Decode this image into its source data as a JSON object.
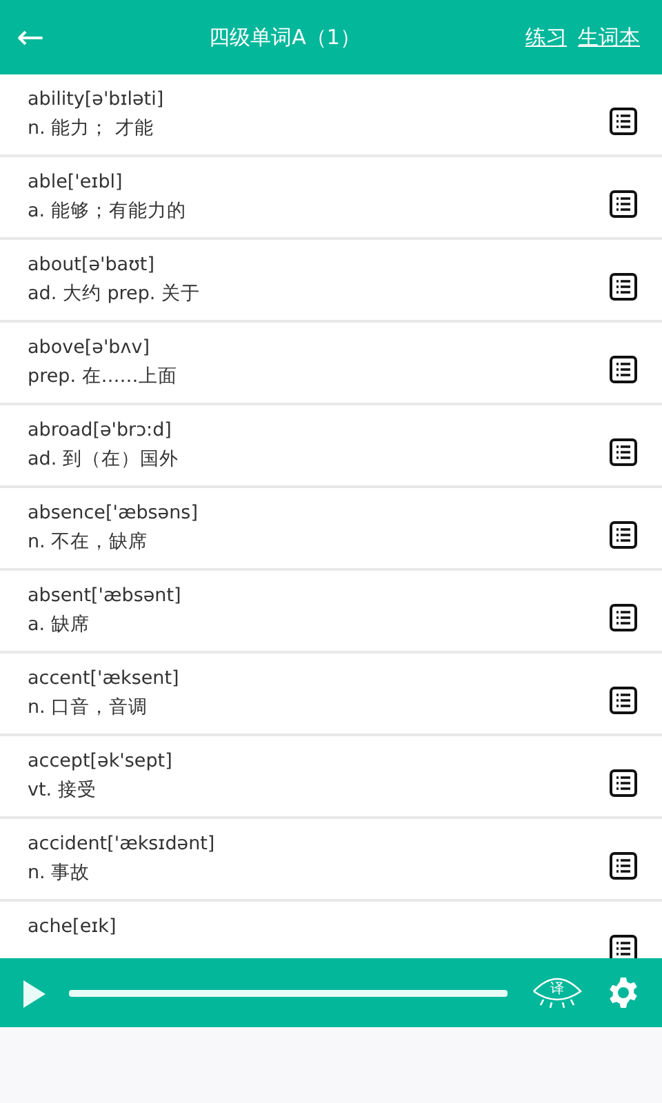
{
  "header": {
    "back": "←",
    "title": "四级单词A（1）",
    "links": [
      "练习",
      "生词本"
    ]
  },
  "words": [
    {
      "word": "ability[ə'bɪləti]",
      "meaning": "n. 能力； 才能"
    },
    {
      "word": "able['eɪbl]",
      "meaning": "a. 能够；有能力的"
    },
    {
      "word": "about[ə'baʊt]",
      "meaning": "ad. 大约 prep. 关于"
    },
    {
      "word": "above[ə'bʌv]",
      "meaning": "prep. 在……上面"
    },
    {
      "word": "abroad[ə'brɔ:d]",
      "meaning": "ad. 到（在）国外"
    },
    {
      "word": "absence['æbsəns]",
      "meaning": "n. 不在，缺席"
    },
    {
      "word": "absent['æbsənt]",
      "meaning": "a. 缺席"
    },
    {
      "word": "accent['æksent]",
      "meaning": "n. 口音，音调"
    },
    {
      "word": "accept[ək'sept]",
      "meaning": "vt. 接受"
    },
    {
      "word": "accident['æksɪdənt]",
      "meaning": "n. 事故"
    },
    {
      "word": "ache[eɪk]"
    }
  ],
  "player": {
    "translate_label": "译"
  }
}
